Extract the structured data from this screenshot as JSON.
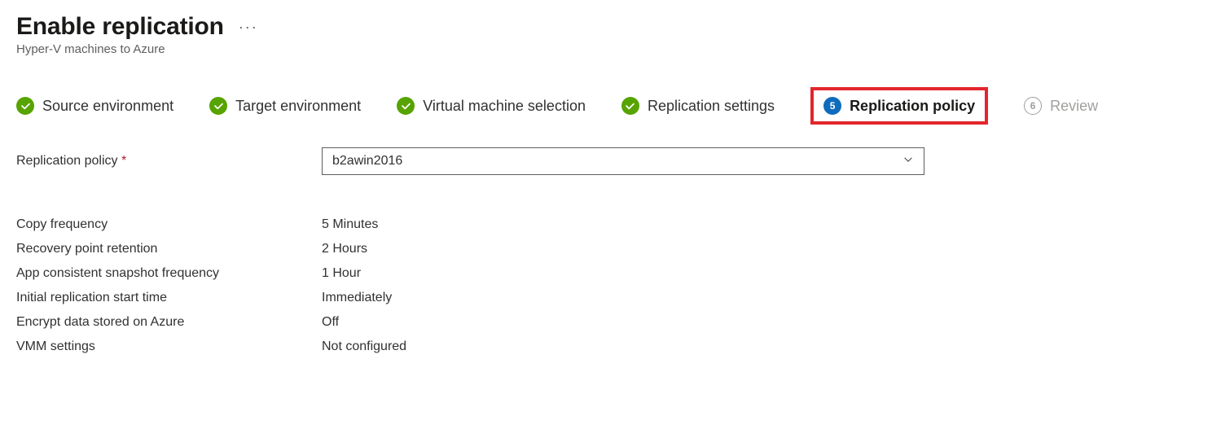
{
  "header": {
    "title": "Enable replication",
    "subtitle": "Hyper-V machines to Azure"
  },
  "wizard": {
    "steps": [
      {
        "label": "Source environment",
        "state": "completed"
      },
      {
        "label": "Target environment",
        "state": "completed"
      },
      {
        "label": "Virtual machine selection",
        "state": "completed"
      },
      {
        "label": "Replication settings",
        "state": "completed"
      },
      {
        "label": "Replication policy",
        "state": "active",
        "number": "5"
      },
      {
        "label": "Review",
        "state": "pending",
        "number": "6"
      }
    ]
  },
  "form": {
    "policy_label": "Replication policy",
    "policy_value": "b2awin2016"
  },
  "details": {
    "rows": [
      {
        "label": "Copy frequency",
        "value": "5 Minutes"
      },
      {
        "label": "Recovery point retention",
        "value": "2 Hours"
      },
      {
        "label": "App consistent snapshot frequency",
        "value": "1 Hour"
      },
      {
        "label": "Initial replication start time",
        "value": "Immediately"
      },
      {
        "label": "Encrypt data stored on Azure",
        "value": "Off"
      },
      {
        "label": "VMM settings",
        "value": "Not configured"
      }
    ]
  }
}
